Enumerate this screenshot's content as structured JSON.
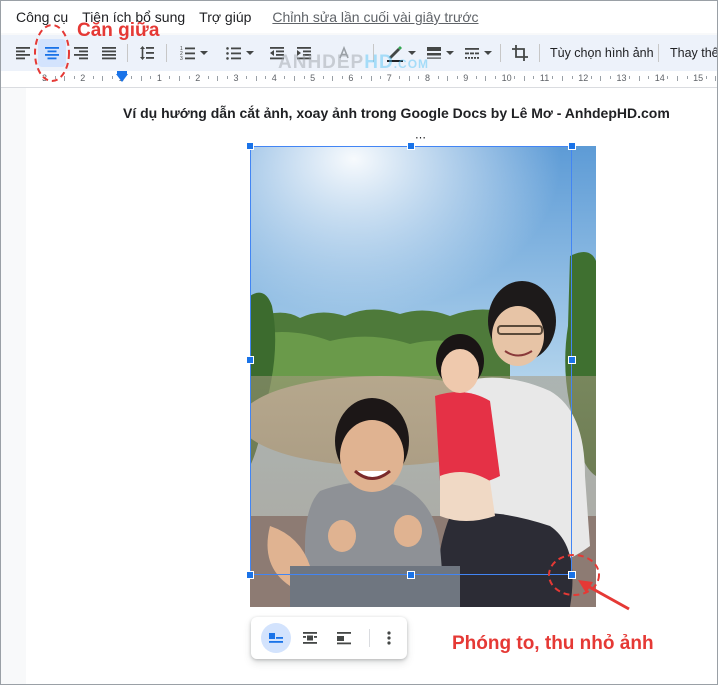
{
  "menu": {
    "items": [
      "Công cụ",
      "Tiện ích bổ sung",
      "Trợ giúp"
    ],
    "last_edit": "Chỉnh sửa lần cuối vài giây trước"
  },
  "toolbar": {
    "image_options_label": "Tùy chọn hình ảnh",
    "replace_label": "Thay thế",
    "icons": [
      "align-left-icon",
      "align-center-icon",
      "align-right-icon",
      "align-justify-icon",
      "line-spacing-icon",
      "numbered-list-icon",
      "bulleted-list-icon",
      "decrease-indent-icon",
      "increase-indent-icon",
      "clear-format-icon",
      "border-color-icon",
      "border-weight-icon",
      "border-dash-icon",
      "crop-icon"
    ]
  },
  "ruler": {
    "numbers": [
      "3",
      "2",
      "1",
      "1",
      "2",
      "3",
      "4",
      "5",
      "6",
      "7",
      "8",
      "9",
      "10",
      "11",
      "12",
      "13",
      "14",
      "15"
    ]
  },
  "watermark": {
    "part1": "ANHDEP",
    "part2": "HD",
    "part3": ".COM"
  },
  "document": {
    "title": "Ví dụ hướng dẫn cắt ảnh, xoay ảnh trong Google Docs by Lê Mơ - AnhdepHD.com",
    "image_menu_glyph": "⋯"
  },
  "image_toolbar": {
    "icons": [
      "wrap-inline-icon",
      "wrap-text-icon",
      "break-text-icon",
      "more-options-icon"
    ]
  },
  "annotations": {
    "center_label": "Căn giữa",
    "resize_label": "Phóng to, thu nhỏ ảnh"
  },
  "colors": {
    "accent": "#1a73e8",
    "annotation": "#e53935",
    "active_bg": "#d3e3fd"
  }
}
